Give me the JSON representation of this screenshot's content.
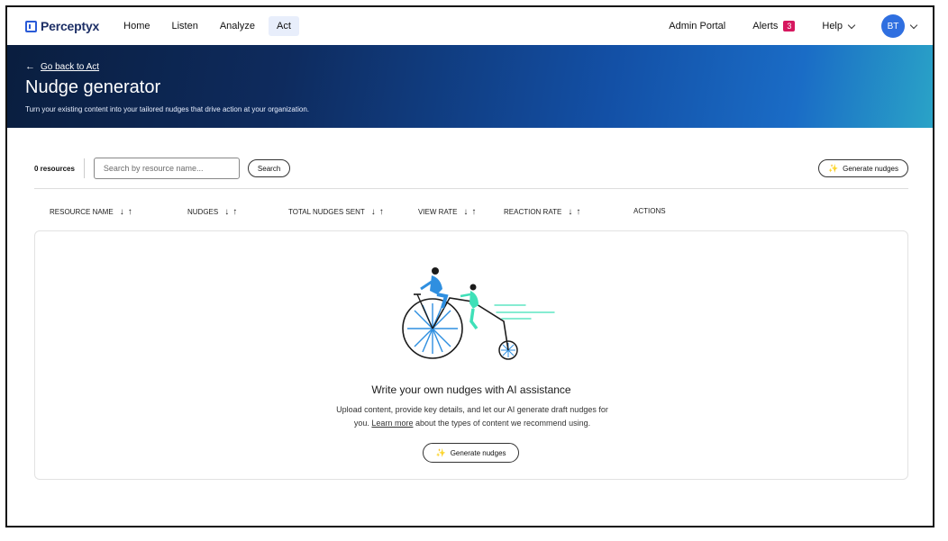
{
  "nav": {
    "brand": "Perceptyx",
    "links": [
      "Home",
      "Listen",
      "Analyze",
      "Act"
    ],
    "active": "Act",
    "admin_portal": "Admin Portal",
    "alerts_label": "Alerts",
    "alerts_count": "3",
    "help_label": "Help",
    "avatar_initials": "BT"
  },
  "hero": {
    "back_label": "Go back to Act",
    "title": "Nudge generator",
    "subtitle": "Turn your existing content into your tailored nudges that drive action at your organization."
  },
  "toolbar": {
    "resource_count": "0 resources",
    "search_placeholder": "Search by resource name...",
    "search_button": "Search",
    "generate_button": "Generate nudges"
  },
  "table": {
    "columns": [
      "RESOURCE NAME",
      "NUDGES",
      "TOTAL NUDGES SENT",
      "VIEW RATE",
      "REACTION RATE",
      "ACTIONS"
    ]
  },
  "empty_state": {
    "title": "Write your own nudges with AI assistance",
    "desc_line1": "Upload content, provide key details, and let our AI generate draft nudges for",
    "desc_line2_pre": "you.",
    "learn_more": "Learn more",
    "desc_line2_post": "about the types of content we recommend using.",
    "generate_button": "Generate nudges"
  },
  "colors": {
    "accent": "#2f6fe0",
    "alert_badge": "#d6185f",
    "illustration_blue": "#2f8fe0",
    "illustration_green": "#3fe0b8"
  }
}
